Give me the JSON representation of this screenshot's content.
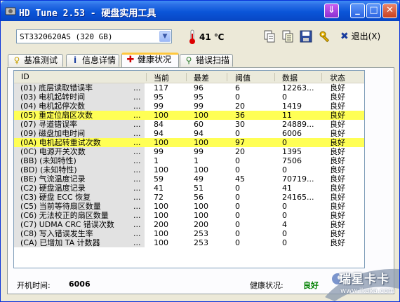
{
  "window": {
    "title": "HD Tune 2.53 - 硬盘实用工具"
  },
  "toolbar": {
    "drive": "ST3320620AS (320 GB)",
    "temperature": "41 ℃",
    "exit_label": "退出(X)"
  },
  "tabs": [
    {
      "label": "基准测试",
      "icon": "benchmark-icon"
    },
    {
      "label": "信息详情",
      "icon": "info-icon"
    },
    {
      "label": "健康状况",
      "icon": "health-cross-icon",
      "active": true
    },
    {
      "label": "错误扫描",
      "icon": "magnifier-icon"
    }
  ],
  "table": {
    "headers": [
      "ID",
      "当前",
      "最差",
      "阈值",
      "数据",
      "状态"
    ],
    "rows": [
      {
        "id": "(01) 底层读取错误率",
        "current": "117",
        "worst": "96",
        "threshold": "6",
        "data": "12263...",
        "status": "良好"
      },
      {
        "id": "(03) 电机起转时间",
        "current": "95",
        "worst": "95",
        "threshold": "0",
        "data": "0",
        "status": "良好"
      },
      {
        "id": "(04) 电机起停次数",
        "current": "99",
        "worst": "99",
        "threshold": "20",
        "data": "1419",
        "status": "良好"
      },
      {
        "id": "(05) 重定位扇区次数",
        "current": "100",
        "worst": "100",
        "threshold": "36",
        "data": "11",
        "status": "良好",
        "highlight": true
      },
      {
        "id": "(07) 寻道错误率",
        "current": "84",
        "worst": "60",
        "threshold": "30",
        "data": "24889...",
        "status": "良好"
      },
      {
        "id": "(09) 磁盘加电时间",
        "current": "94",
        "worst": "94",
        "threshold": "0",
        "data": "6006",
        "status": "良好"
      },
      {
        "id": "(0A) 电机起转重试次数",
        "current": "100",
        "worst": "100",
        "threshold": "97",
        "data": "0",
        "status": "良好",
        "highlight": true
      },
      {
        "id": "(0C) 电源开关次数",
        "current": "99",
        "worst": "99",
        "threshold": "20",
        "data": "1395",
        "status": "良好"
      },
      {
        "id": "(BB) (未知特性)",
        "current": "1",
        "worst": "1",
        "threshold": "0",
        "data": "7506",
        "status": "良好"
      },
      {
        "id": "(BD) (未知特性)",
        "current": "100",
        "worst": "100",
        "threshold": "0",
        "data": "0",
        "status": "良好"
      },
      {
        "id": "(BE) 气流温度记录",
        "current": "59",
        "worst": "49",
        "threshold": "45",
        "data": "70719...",
        "status": "良好"
      },
      {
        "id": "(C2) 硬盘温度记录",
        "current": "41",
        "worst": "51",
        "threshold": "0",
        "data": "41",
        "status": "良好"
      },
      {
        "id": "(C3) 硬盘 ECC 恢复",
        "current": "72",
        "worst": "56",
        "threshold": "0",
        "data": "24165...",
        "status": "良好"
      },
      {
        "id": "(C5) 当前等待扇区数量",
        "current": "100",
        "worst": "100",
        "threshold": "0",
        "data": "0",
        "status": "良好"
      },
      {
        "id": "(C6) 无法校正的扇区数量",
        "current": "100",
        "worst": "100",
        "threshold": "0",
        "data": "0",
        "status": "良好"
      },
      {
        "id": "(C7) UDMA CRC 错误次数",
        "current": "200",
        "worst": "200",
        "threshold": "0",
        "data": "4",
        "status": "良好"
      },
      {
        "id": "(C8) 写入错误发生率",
        "current": "100",
        "worst": "253",
        "threshold": "0",
        "data": "0",
        "status": "良好"
      },
      {
        "id": "(CA) 已增加 TA 计数器",
        "current": "100",
        "worst": "253",
        "threshold": "0",
        "data": "0",
        "status": "良好"
      }
    ],
    "ellipsis": "..."
  },
  "status": {
    "power_on_label": "开机时间:",
    "power_on_value": "6006",
    "health_label": "健康状况:",
    "health_value": "良好",
    "health_color": "#008000"
  },
  "watermark": {
    "brand": "瑞星卡卡",
    "url": "www.ikaka.com"
  },
  "colors": {
    "highlight": "#ffff55",
    "title_bar": "#0a55d8"
  }
}
